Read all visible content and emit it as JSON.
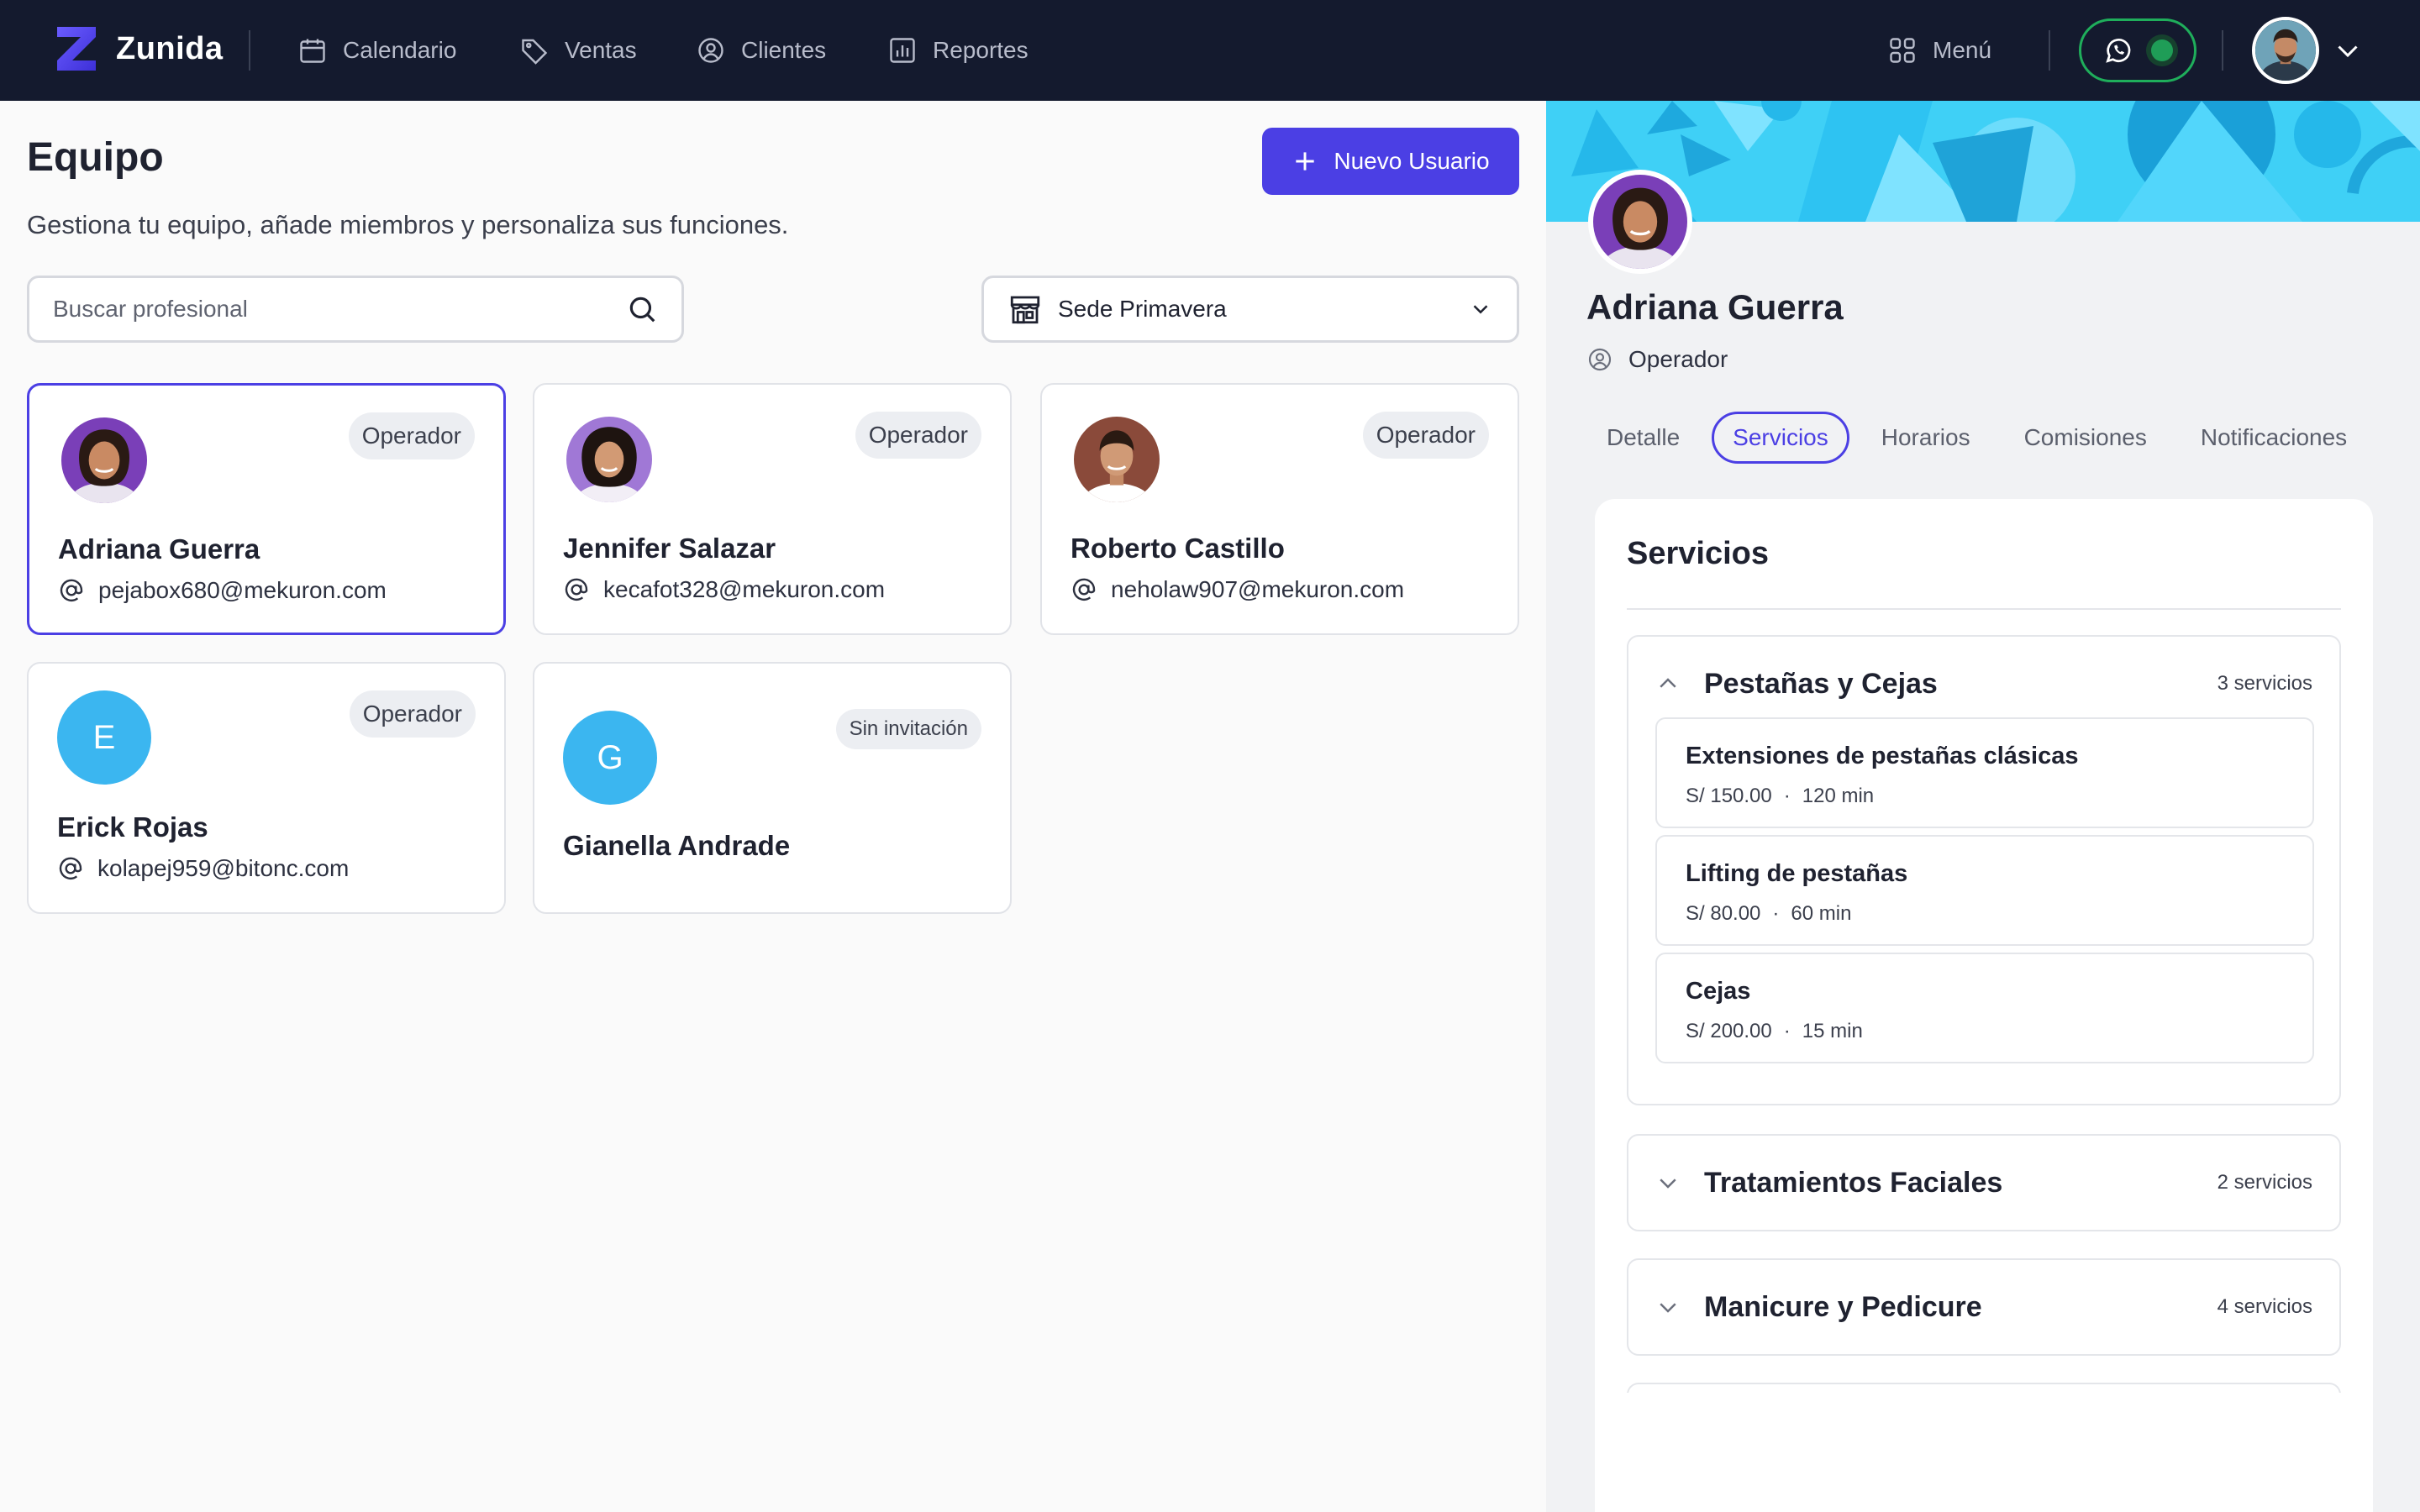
{
  "app": {
    "name": "Zunida",
    "nav": [
      {
        "label": "Calendario",
        "icon": "calendar-icon"
      },
      {
        "label": "Ventas",
        "icon": "tag-icon"
      },
      {
        "label": "Clientes",
        "icon": "user-circle-icon"
      },
      {
        "label": "Reportes",
        "icon": "bar-chart-icon"
      }
    ],
    "menu_label": "Menú"
  },
  "team": {
    "title": "Equipo",
    "subtitle": "Gestiona tu equipo, añade miembros y personaliza sus funciones.",
    "new_user_label": "Nuevo Usuario",
    "search_placeholder": "Buscar profesional",
    "location": "Sede Primavera",
    "members": [
      {
        "name": "Adriana Guerra",
        "role": "Operador",
        "email": "pejabox680@mekuron.com",
        "avatar": "photo",
        "selected": true
      },
      {
        "name": "Jennifer Salazar",
        "role": "Operador",
        "email": "kecafot328@mekuron.com",
        "avatar": "photo"
      },
      {
        "name": "Roberto Castillo",
        "role": "Operador",
        "email": "neholaw907@mekuron.com",
        "avatar": "photo"
      },
      {
        "name": "Erick Rojas",
        "role": "Operador",
        "email": "kolapej959@bitonc.com",
        "avatar": "E"
      },
      {
        "name": "Gianella Andrade",
        "role": "Sin invitación",
        "email": "",
        "avatar": "G"
      }
    ]
  },
  "profile": {
    "name": "Adriana Guerra",
    "role": "Operador",
    "tabs": [
      "Detalle",
      "Servicios",
      "Horarios",
      "Comisiones",
      "Notificaciones"
    ],
    "active_tab": "Servicios",
    "section_title": "Servicios",
    "groups": [
      {
        "title": "Pestañas y Cejas",
        "count": "3 servicios",
        "expanded": true,
        "services": [
          {
            "name": "Extensiones de pestañas clásicas",
            "price": "S/ 150.00",
            "duration": "120 min"
          },
          {
            "name": "Lifting de pestañas",
            "price": "S/ 80.00",
            "duration": "60 min"
          },
          {
            "name": "Cejas",
            "price": "S/ 200.00",
            "duration": "15 min"
          }
        ]
      },
      {
        "title": "Tratamientos Faciales",
        "count": "2 servicios",
        "expanded": false
      },
      {
        "title": "Manicure y Pedicure",
        "count": "4 servicios",
        "expanded": false
      }
    ]
  },
  "colors": {
    "brand": "#4b3fe4",
    "topbar": "#141a2e",
    "whatsapp": "#1fae5b",
    "banner": "#3fd0f6",
    "letter_avatar": "#3bb6f0"
  }
}
